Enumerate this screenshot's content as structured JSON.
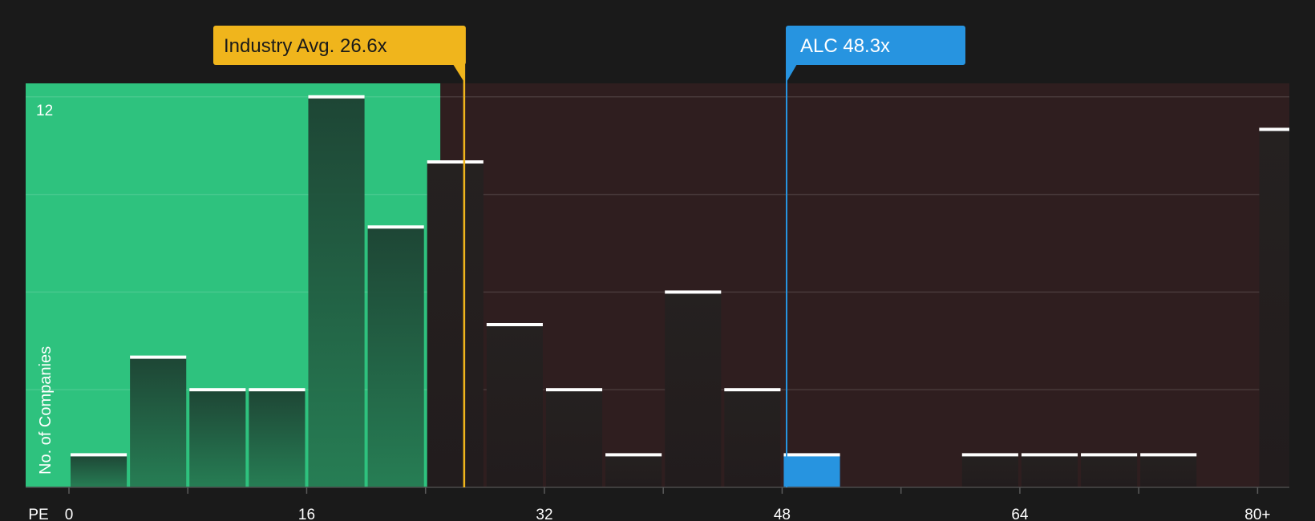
{
  "chart_data": {
    "type": "bar",
    "xlabel": "PE",
    "ylabel": "No. of Companies",
    "x_ticks": [
      "0",
      "16",
      "32",
      "48",
      "64",
      "80+"
    ],
    "y_tick_label": "12",
    "bin_width": 4,
    "bins": [
      {
        "start": 0,
        "count": 1
      },
      {
        "start": 4,
        "count": 4
      },
      {
        "start": 8,
        "count": 3
      },
      {
        "start": 12,
        "count": 3
      },
      {
        "start": 16,
        "count": 12
      },
      {
        "start": 20,
        "count": 8
      },
      {
        "start": 24,
        "count": 10
      },
      {
        "start": 28,
        "count": 5
      },
      {
        "start": 32,
        "count": 3
      },
      {
        "start": 36,
        "count": 1
      },
      {
        "start": 40,
        "count": 6
      },
      {
        "start": 44,
        "count": 3
      },
      {
        "start": 48,
        "count": 1,
        "highlight": true
      },
      {
        "start": 60,
        "count": 1
      },
      {
        "start": 64,
        "count": 1
      },
      {
        "start": 68,
        "count": 1
      },
      {
        "start": 72,
        "count": 1
      },
      {
        "start": 80,
        "count": 11
      }
    ],
    "xlim": [
      0,
      82
    ],
    "ylim": [
      0,
      12.4
    ],
    "grid": true,
    "fair_range_max": 25,
    "industry_avg": {
      "label": "Industry Avg. 26.6x",
      "value": 26.6
    },
    "company": {
      "label": "ALC 48.3x",
      "value": 48.3
    },
    "colors": {
      "background": "#1a1a1a",
      "undervalued_zone": "#2ec27e",
      "overvalued_zone": "#2f1e1f",
      "bar_in_green": "#1f5c3e",
      "bar_dark": "#262222",
      "bar_highlight": "#2794e0",
      "industry": "#f0b51c",
      "company": "#2794e0"
    }
  }
}
